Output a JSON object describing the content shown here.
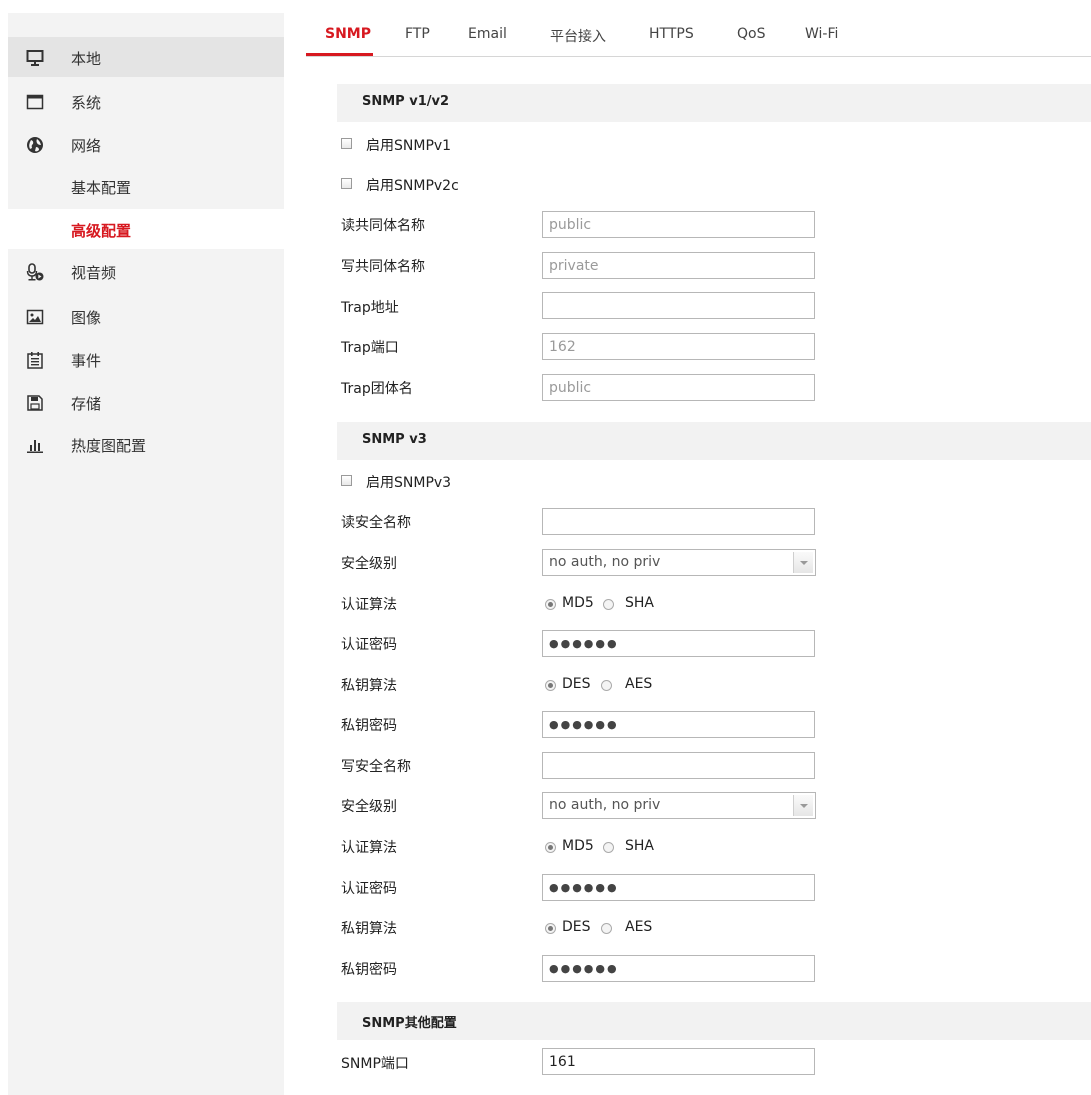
{
  "sidebar": {
    "items": [
      {
        "label": "本地",
        "icon": "monitor-icon"
      },
      {
        "label": "系统",
        "icon": "window-icon"
      },
      {
        "label": "网络",
        "icon": "globe-icon"
      },
      {
        "label": "基本配置"
      },
      {
        "label": "高级配置"
      },
      {
        "label": "视音频",
        "icon": "microphone-icon"
      },
      {
        "label": "图像",
        "icon": "image-icon"
      },
      {
        "label": "事件",
        "icon": "calendar-icon"
      },
      {
        "label": "存储",
        "icon": "save-icon"
      },
      {
        "label": "热度图配置",
        "icon": "bar-chart-icon"
      }
    ]
  },
  "tabs": [
    "SNMP",
    "FTP",
    "Email",
    "平台接入",
    "HTTPS",
    "QoS",
    "Wi-Fi"
  ],
  "colors": {
    "accent": "#d71920",
    "sidebar_bg": "#f3f3f3",
    "section_bg": "#f2f2f2"
  },
  "v12": {
    "title": "SNMP v1/v2",
    "enable_v1": "启用SNMPv1",
    "enable_v2c": "启用SNMPv2c",
    "read_community_label": "读共同体名称",
    "read_community_value": "public",
    "write_community_label": "写共同体名称",
    "write_community_value": "private",
    "trap_address_label": "Trap地址",
    "trap_address_value": "",
    "trap_port_label": "Trap端口",
    "trap_port_value": "162",
    "trap_community_label": "Trap团体名",
    "trap_community_value": "public"
  },
  "v3": {
    "title": "SNMP v3",
    "enable_v3": "启用SNMPv3",
    "read_name_label": "读安全名称",
    "read_name_value": "",
    "read_level_label": "安全级别",
    "read_level_value": "no auth, no priv",
    "read_auth_algo_label": "认证算法",
    "read_auth_pwd_label": "认证密码",
    "read_priv_algo_label": "私钥算法",
    "read_priv_pwd_label": "私钥密码",
    "write_name_label": "写安全名称",
    "write_name_value": "",
    "write_level_label": "安全级别",
    "write_level_value": "no auth, no priv",
    "write_auth_algo_label": "认证算法",
    "write_auth_pwd_label": "认证密码",
    "write_priv_algo_label": "私钥算法",
    "write_priv_pwd_label": "私钥密码",
    "password_mask": "●●●●●●",
    "auth_options": [
      "MD5",
      "SHA"
    ],
    "priv_options": [
      "DES",
      "AES"
    ]
  },
  "other": {
    "title": "SNMP其他配置",
    "port_label": "SNMP端口",
    "port_value": "161"
  }
}
